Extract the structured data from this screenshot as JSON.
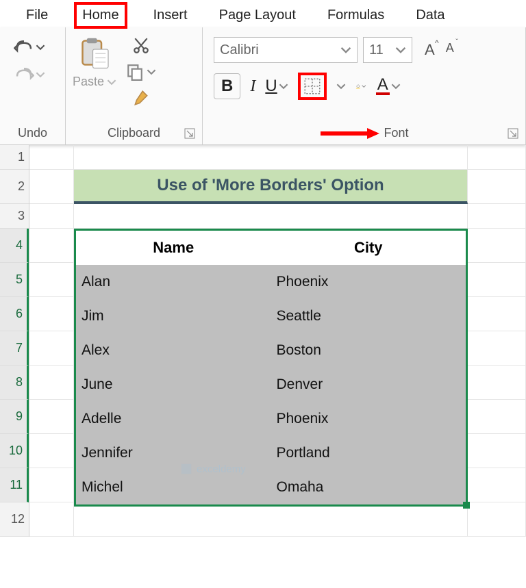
{
  "tabs": {
    "file": "File",
    "home": "Home",
    "insert": "Insert",
    "page_layout": "Page Layout",
    "formulas": "Formulas",
    "data": "Data"
  },
  "groups": {
    "undo": "Undo",
    "clipboard": "Clipboard",
    "paste": "Paste",
    "font": "Font"
  },
  "font": {
    "name": "Calibri",
    "size": "11",
    "bold": "B",
    "italic": "I",
    "underline": "U",
    "inc": "A",
    "dec": "A",
    "color_letter": "A"
  },
  "rows": [
    "1",
    "2",
    "3",
    "4",
    "5",
    "6",
    "7",
    "8",
    "9",
    "10",
    "11",
    "12"
  ],
  "title": "Use of 'More Borders' Option",
  "headers": {
    "name": "Name",
    "city": "City"
  },
  "data_rows": [
    {
      "name": "Alan",
      "city": "Phoenix"
    },
    {
      "name": "Jim",
      "city": "Seattle"
    },
    {
      "name": "Alex",
      "city": "Boston"
    },
    {
      "name": "June",
      "city": "Denver"
    },
    {
      "name": "Adelle",
      "city": "Phoenix"
    },
    {
      "name": "Jennifer",
      "city": "Portland"
    },
    {
      "name": "Michel",
      "city": "Omaha"
    }
  ],
  "watermark": "exceldemy"
}
